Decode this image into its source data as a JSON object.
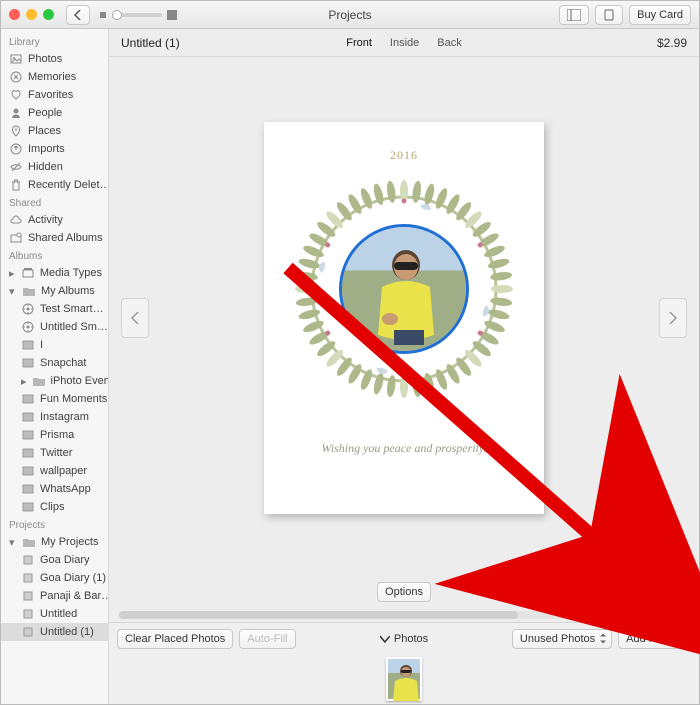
{
  "titlebar": {
    "title": "Projects",
    "buy_label": "Buy Card"
  },
  "sidebar": {
    "library_h": "Library",
    "library": [
      {
        "icon": "photos",
        "label": "Photos"
      },
      {
        "icon": "memories",
        "label": "Memories"
      },
      {
        "icon": "favorites",
        "label": "Favorites"
      },
      {
        "icon": "people",
        "label": "People"
      },
      {
        "icon": "places",
        "label": "Places"
      },
      {
        "icon": "imports",
        "label": "Imports"
      },
      {
        "icon": "hidden",
        "label": "Hidden"
      },
      {
        "icon": "trash",
        "label": "Recently Delet…"
      }
    ],
    "shared_h": "Shared",
    "shared": [
      {
        "icon": "cloud",
        "label": "Activity"
      },
      {
        "icon": "shared",
        "label": "Shared Albums"
      }
    ],
    "albums_h": "Albums",
    "albums_top": [
      {
        "icon": "stack",
        "label": "Media Types",
        "disclosure": "right"
      }
    ],
    "my_albums_label": "My Albums",
    "my_albums": [
      {
        "icon": "smart",
        "label": "Test Smart…"
      },
      {
        "icon": "smart",
        "label": "Untitled Sm…"
      },
      {
        "icon": "album",
        "label": "I"
      },
      {
        "icon": "album",
        "label": "Snapchat"
      },
      {
        "icon": "folder",
        "label": "iPhoto Events",
        "disclosure": "right"
      },
      {
        "icon": "album",
        "label": "Fun Moments"
      },
      {
        "icon": "album",
        "label": "Instagram"
      },
      {
        "icon": "album",
        "label": "Prisma"
      },
      {
        "icon": "album",
        "label": "Twitter"
      },
      {
        "icon": "album",
        "label": "wallpaper"
      },
      {
        "icon": "album",
        "label": "WhatsApp"
      },
      {
        "icon": "album",
        "label": "Clips"
      }
    ],
    "projects_h": "Projects",
    "my_projects_label": "My Projects",
    "projects": [
      {
        "icon": "book",
        "label": "Goa Diary"
      },
      {
        "icon": "book",
        "label": "Goa Diary (1)"
      },
      {
        "icon": "book",
        "label": "Panaji & Bar…"
      },
      {
        "icon": "book",
        "label": "Untitled"
      },
      {
        "icon": "book",
        "label": "Untitled (1)",
        "selected": true
      }
    ]
  },
  "subbar": {
    "project_name": "Untitled (1)",
    "views": [
      "Front",
      "Inside",
      "Back"
    ],
    "active_view": "Front",
    "price": "$2.99"
  },
  "card": {
    "year": "2016",
    "message": "Wishing you peace and prosperity."
  },
  "options_label": "Options",
  "bottom": {
    "clear_label": "Clear Placed Photos",
    "autofill_label": "Auto-Fill",
    "photos_label": "Photos",
    "filter_selected": "Unused Photos",
    "add_label": "Add Photos"
  }
}
